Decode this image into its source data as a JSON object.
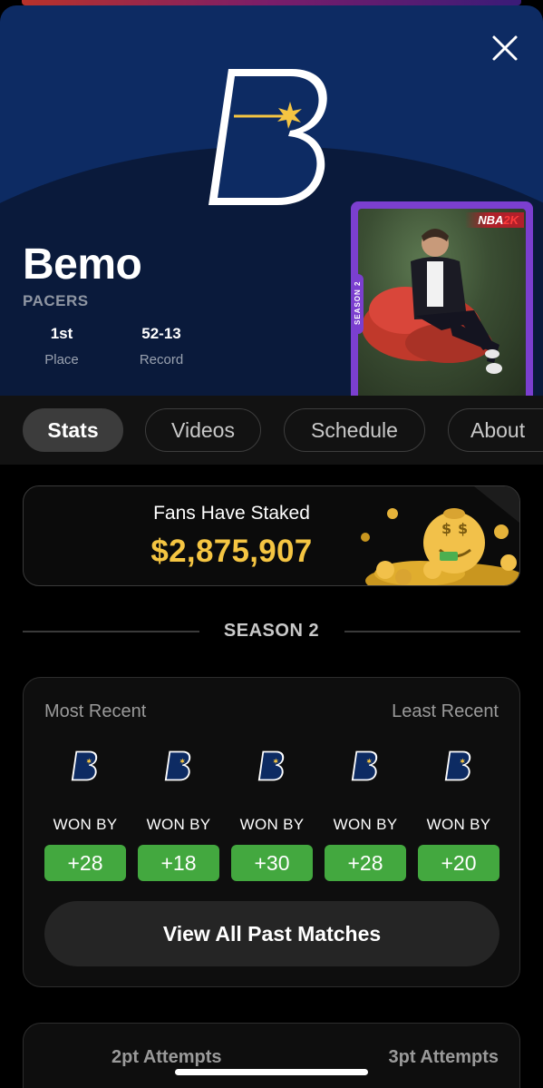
{
  "player": {
    "name": "Bemo",
    "team": "PACERS",
    "stats": [
      {
        "value": "1st",
        "label": "Place"
      },
      {
        "value": "52-13",
        "label": "Record"
      }
    ]
  },
  "card": {
    "brand_nba": "NBA",
    "brand_2k": "2K",
    "season_tab": "SEASON 2"
  },
  "tabs": [
    {
      "label": "Stats",
      "active": true
    },
    {
      "label": "Videos",
      "active": false
    },
    {
      "label": "Schedule",
      "active": false
    },
    {
      "label": "About",
      "active": false
    }
  ],
  "stake": {
    "title": "Fans Have Staked",
    "amount": "$2,875,907"
  },
  "season": {
    "label": "SEASON 2"
  },
  "matches": {
    "most_recent_label": "Most Recent",
    "least_recent_label": "Least Recent",
    "results": [
      {
        "label": "WON BY",
        "margin": "+28"
      },
      {
        "label": "WON BY",
        "margin": "+18"
      },
      {
        "label": "WON BY",
        "margin": "+30"
      },
      {
        "label": "WON BY",
        "margin": "+28"
      },
      {
        "label": "WON BY",
        "margin": "+20"
      }
    ],
    "view_all_label": "View All Past Matches"
  },
  "attempts": {
    "two_pt_label": "2pt Attempts",
    "three_pt_label": "3pt Attempts"
  },
  "colors": {
    "header_blue": "#0d2b63",
    "accent_gold": "#f5c542",
    "win_green": "#43a83f",
    "card_purple": "#7b3fcf"
  },
  "icons": {
    "close": "close-icon",
    "team_logo": "pacers-b-logo"
  }
}
